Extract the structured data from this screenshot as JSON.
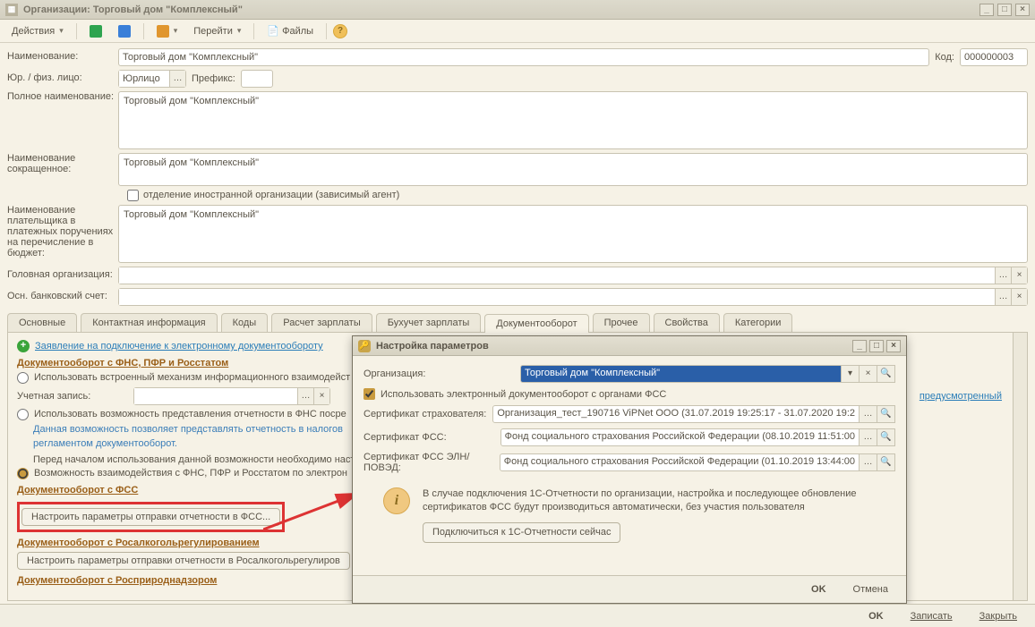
{
  "window": {
    "title": "Организации: Торговый дом \"Комплексный\""
  },
  "toolbar": {
    "actions": "Действия",
    "goto": "Перейти",
    "files": "Файлы"
  },
  "form": {
    "name_label": "Наименование:",
    "name_value": "Торговый дом \"Комплексный\"",
    "code_label": "Код:",
    "code_value": "000000003",
    "legal_label": "Юр. / физ. лицо:",
    "legal_value": "Юрлицо",
    "prefix_label": "Префикс:",
    "prefix_value": "",
    "fullname_label": "Полное наименование:",
    "fullname_value": "Торговый дом \"Комплексный\"",
    "shortname_label": "Наименование сокращенное:",
    "shortname_value": "Торговый дом \"Комплексный\"",
    "foreign_check": "отделение иностранной организации (зависимый агент)",
    "payer_label": "Наименование плательщика в платежных поручениях на перечисление в бюджет:",
    "payer_value": "Торговый дом \"Комплексный\"",
    "parent_label": "Головная организация:",
    "bank_label": "Осн. банковский счет:"
  },
  "tabs": [
    "Основные",
    "Контактная информация",
    "Коды",
    "Расчет зарплаты",
    "Бухучет зарплаты",
    "Документооборот",
    "Прочее",
    "Свойства",
    "Категории"
  ],
  "active_tab": 5,
  "doc": {
    "app_link": "Заявление на подключение к электронному документообороту",
    "section1": "Документооборот с ФНС, ПФР и Росстатом",
    "radio1": "Использовать встроенный механизм информационного взаимодейст",
    "acct_label": "Учетная запись:",
    "extra_link": "предусмотренный",
    "radio2": "Использовать возможность представления отчетности в ФНС посре",
    "desc1": "Данная возможность позволяет представлять отчетность в налогов",
    "desc2": "регламентом документооборот.",
    "desc3": "Перед началом использования данной возможности необходимо наст",
    "radio3": "Возможность взаимодействия с ФНС, ПФР и Росстатом по электрон",
    "section2": "Документооборот с ФСС",
    "btn_fss": "Настроить параметры отправки отчетности в ФСС...",
    "section3": "Документооборот c Росалкогольрегулированием",
    "btn_alc": "Настроить параметры отправки отчетности в Росалкогольрегулиров",
    "section4": "Документооборот c Росприроднадзором"
  },
  "modal": {
    "title": "Настройка параметров",
    "org_label": "Организация:",
    "org_value": "Торговый дом \"Комплексный\"",
    "use_edo": "Использовать электронный документооборот с органами ФСС",
    "cert1_label": "Сертификат страхователя:",
    "cert1_value": "Организация_тест_190716 ViPNet ООО (31.07.2019 19:25:17 - 31.07.2020 19:2",
    "cert2_label": "Сертификат ФСС:",
    "cert2_value": "Фонд социального страхования Российской Федерации (08.10.2019 11:51:00",
    "cert3_label": "Сертификат ФСС ЭЛН/ПОВЭД:",
    "cert3_value": "Фонд социального страхования Российской Федерации (01.10.2019 13:44:00",
    "info1": "В случае подключения 1С-Отчетности по организации, настройка и последующее обновление сертификатов ФСС будут производиться автоматически, без участия пользователя",
    "connect_btn": "Подключиться к 1С-Отчетности сейчас",
    "ok": "OK",
    "cancel": "Отмена"
  },
  "footer": {
    "ok": "OK",
    "save": "Записать",
    "close": "Закрыть"
  }
}
